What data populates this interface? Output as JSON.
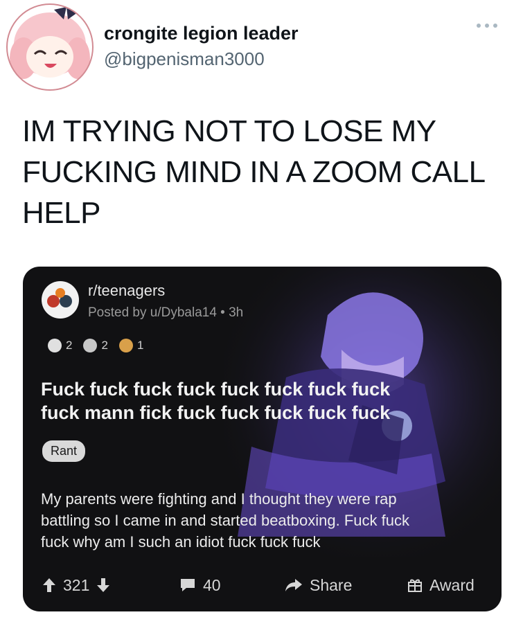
{
  "tweet": {
    "display_name": "crongite legion leader",
    "handle": "@bigpenisman3000",
    "text_lines": [
      "IM TRYING NOT TO LOSE MY",
      "FUCKING MIND IN A ZOOM CALL",
      "HELP"
    ],
    "more_icon": "ellipsis-icon"
  },
  "reddit_post": {
    "subreddit": "r/teenagers",
    "meta": "Posted by u/Dybala14 • 3h",
    "awards": [
      {
        "icon": "award-wholesome-icon",
        "count": "2",
        "color": "#e0e0e0"
      },
      {
        "icon": "award-silver-icon",
        "count": "2",
        "color": "#c8c8c8"
      },
      {
        "icon": "award-facepalm-icon",
        "count": "1",
        "color": "#d9a04a"
      }
    ],
    "title_lines": [
      "Fuck fuck fuck fuck fuck fuck fuck fuck",
      "fuck mann fick fuck fuck fuck fuck fuck"
    ],
    "flair": "Rant",
    "body_lines": [
      "My parents were fighting and I thought they were rap",
      "battling so I  came in and started beatboxing. Fuck fuck",
      "fuck why am I such an idiot fuck fuck fuck"
    ],
    "votes": "321",
    "comments": "40",
    "share_label": "Share",
    "award_label": "Award",
    "card_bg": "#111113",
    "art_color": "#6a4fd0"
  }
}
